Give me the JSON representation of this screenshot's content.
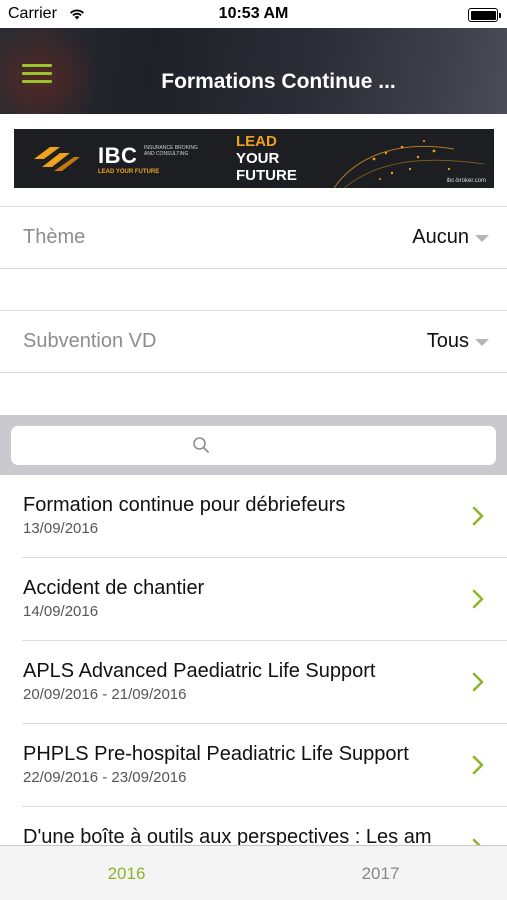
{
  "status_bar": {
    "carrier": "Carrier",
    "time": "10:53 AM",
    "wifi_icon": "wifi-icon",
    "battery_icon": "battery-icon",
    "battery_level": 1.0
  },
  "nav": {
    "title": "Formations Continue ...",
    "menu_icon": "hamburger-menu-icon",
    "menu_color": "#9ac22a"
  },
  "banner": {
    "brand": "IBC",
    "brand_subtitle": "INSURANCE BROKING AND CONSULTING",
    "tagline": "LEAD YOUR FUTURE",
    "headline_line1": "LEAD",
    "headline_line2": "YOUR",
    "headline_line3": "FUTURE",
    "url": "ibc-broker.com",
    "accent_color": "#f0a11d"
  },
  "filters": [
    {
      "label": "Thème",
      "value": "Aucun"
    },
    {
      "label": "Subvention VD",
      "value": "Tous"
    }
  ],
  "search": {
    "placeholder": "",
    "icon": "search-icon"
  },
  "items": [
    {
      "title": "Formation continue pour débriefeurs",
      "date": "13/09/2016"
    },
    {
      "title": "Accident de chantier",
      "date": "14/09/2016"
    },
    {
      "title": "APLS Advanced Paediatric Life Support",
      "date": "20/09/2016 - 21/09/2016"
    },
    {
      "title": "PHPLS Pre-hospital Peadiatric Life Support",
      "date": "22/09/2016 - 23/09/2016"
    },
    {
      "title": "D'une boîte à outils aux perspectives : Les am",
      "date": ""
    }
  ],
  "tabs": [
    {
      "label": "2016",
      "active": true
    },
    {
      "label": "2017",
      "active": false
    }
  ],
  "colors": {
    "accent_green": "#8fb42c",
    "chevron_green": "#8fb42c"
  }
}
